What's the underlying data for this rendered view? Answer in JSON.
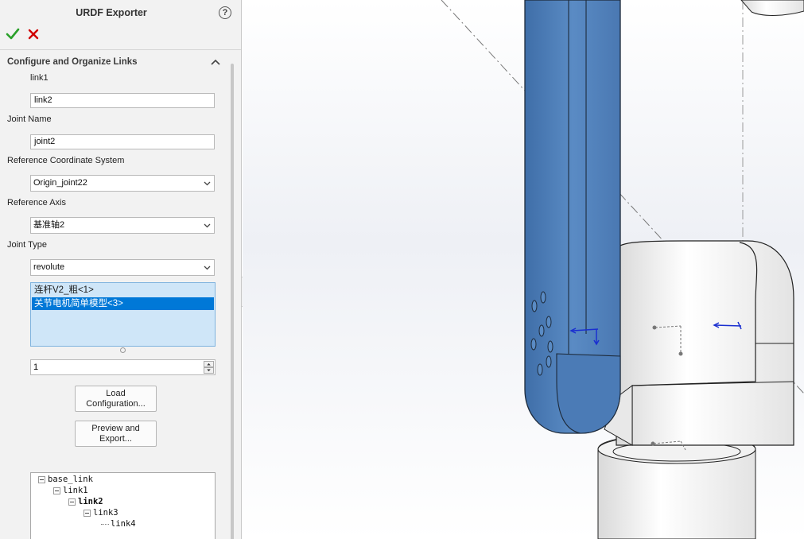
{
  "panel": {
    "title": "URDF Exporter",
    "help_glyph": "?",
    "section_title": "Configure and Organize Links",
    "parent_link": "link1",
    "link_name_value": "link2",
    "joint_name_label": "Joint Name",
    "joint_name_value": "joint2",
    "ref_coord_label": "Reference Coordinate System",
    "ref_coord_value": "Origin_joint22",
    "ref_axis_label": "Reference Axis",
    "ref_axis_value": "基准轴2",
    "joint_type_label": "Joint Type",
    "joint_type_value": "revolute",
    "components": [
      {
        "label": "连杆V2_粗<1>",
        "selected": false
      },
      {
        "label": "关节电机简单模型<3>",
        "selected": true
      }
    ],
    "child_count": "1",
    "load_button_lines": [
      "Load",
      "Configuration..."
    ],
    "preview_button_lines": [
      "Preview and",
      "Export..."
    ],
    "tree": [
      {
        "label": "base_link",
        "bold": false
      },
      {
        "label": "link1",
        "bold": false
      },
      {
        "label": "link2",
        "bold": true
      },
      {
        "label": "link3",
        "bold": false
      },
      {
        "label": "link4",
        "bold": false
      }
    ],
    "icons": [
      "help-icon",
      "checkmark-icon",
      "close-icon",
      "chevron-up-icon",
      "chevron-down-icon"
    ],
    "colors": {
      "accept": "#2aa02a",
      "cancel": "#d00000",
      "selection": "#0078d7",
      "link_blue": "#4f7fb8"
    }
  }
}
